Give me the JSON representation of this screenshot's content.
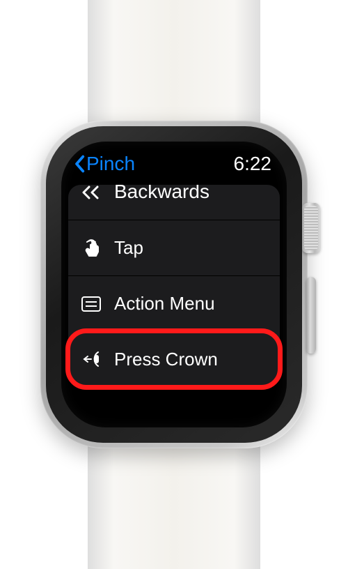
{
  "header": {
    "back_label": "Pinch",
    "time": "6:22"
  },
  "items": {
    "backwards": {
      "label": "Backwards"
    },
    "tap": {
      "label": "Tap"
    },
    "action_menu": {
      "label": "Action Menu"
    },
    "press_crown": {
      "label": "Press Crown"
    }
  }
}
